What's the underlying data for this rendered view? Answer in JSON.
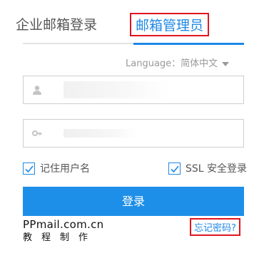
{
  "tabs": {
    "enterprise_label": "企业邮箱登录",
    "admin_label": "邮箱管理员"
  },
  "language": {
    "label": "Language：",
    "selected": "简体中文"
  },
  "fields": {
    "username_value": "",
    "password_value": ""
  },
  "checkboxes": {
    "remember_label": "记住用户名",
    "remember_checked": true,
    "ssl_label": "SSL 安全登录",
    "ssl_checked": true
  },
  "login_button": "登录",
  "brand": {
    "line1": "PPmail.com.cn",
    "line2": "教程制作"
  },
  "forgot_password": "忘记密码?",
  "colors": {
    "accent": "#1e88e5",
    "highlight_border": "#e0151f"
  }
}
